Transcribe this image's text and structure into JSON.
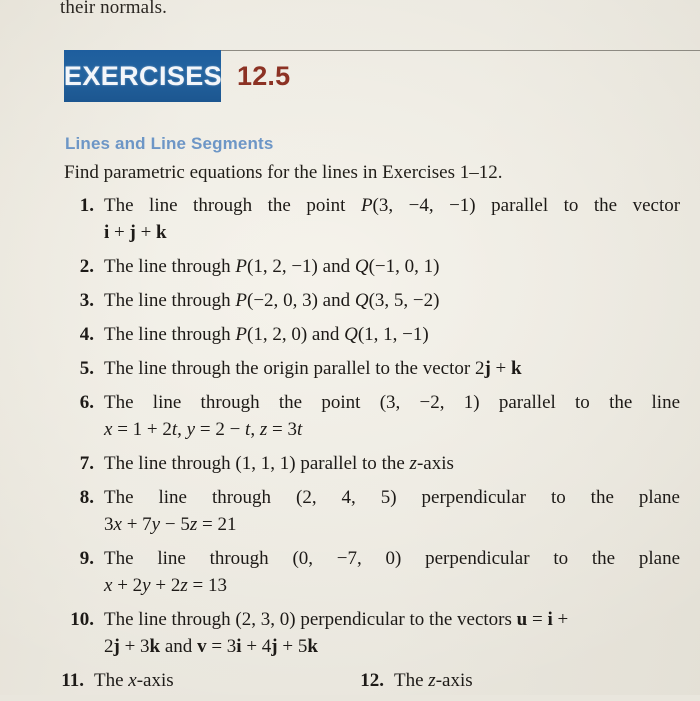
{
  "page": {
    "top_fragment": "their normals.",
    "background_color": "#e9e6dd",
    "rule_color": "#8d8a82"
  },
  "header": {
    "badge_label": "EXERCISES",
    "section_number": "12.5",
    "badge_color": "#1f5f9c",
    "badge_text_color": "#f3f6fa",
    "number_color": "#8c3224"
  },
  "subsection": {
    "title": "Lines and Line Segments",
    "title_color": "#6d96c6",
    "directions": "Find parametric equations for the lines in Exercises 1–12."
  },
  "exercises": [
    {
      "number": "1.",
      "lines": [
        {
          "text": "The line through the point P(3, −4, −1) parallel to the vector",
          "justify": true
        },
        {
          "text": "i + j + k",
          "justify": false
        }
      ]
    },
    {
      "number": "2.",
      "lines": [
        {
          "text": "The line through P(1, 2, −1) and Q(−1, 0, 1)",
          "justify": false
        }
      ]
    },
    {
      "number": "3.",
      "lines": [
        {
          "text": "The line through P(−2, 0, 3) and Q(3, 5, −2)",
          "justify": false
        }
      ]
    },
    {
      "number": "4.",
      "lines": [
        {
          "text": "The line through P(1, 2, 0) and Q(1, 1, −1)",
          "justify": false
        }
      ]
    },
    {
      "number": "5.",
      "lines": [
        {
          "text": "The line through the origin parallel to the vector 2j + k",
          "justify": false
        }
      ]
    },
    {
      "number": "6.",
      "lines": [
        {
          "text": "The line through the point (3, −2, 1) parallel to the line",
          "justify": true
        },
        {
          "text": "x = 1 + 2t, y = 2 − t, z = 3t",
          "justify": false
        }
      ]
    },
    {
      "number": "7.",
      "lines": [
        {
          "text": "The line through (1, 1, 1) parallel to the z-axis",
          "justify": false
        }
      ]
    },
    {
      "number": "8.",
      "lines": [
        {
          "text": "The line through (2, 4, 5) perpendicular to the plane",
          "justify": true
        },
        {
          "text": "3x + 7y − 5z = 21",
          "justify": false
        }
      ]
    },
    {
      "number": "9.",
      "lines": [
        {
          "text": "The line through (0, −7, 0) perpendicular to the plane",
          "justify": true
        },
        {
          "text": "x + 2y + 2z = 13",
          "justify": false
        }
      ]
    },
    {
      "number": "10.",
      "lines": [
        {
          "text": "The line through (2, 3, 0) perpendicular to the vectors u = i +",
          "justify": false
        },
        {
          "text": "2j + 3k and v = 3i + 4j + 5k",
          "justify": false
        }
      ]
    }
  ],
  "exercise_pair": {
    "left": {
      "number": "11.",
      "text": "The x-axis"
    },
    "right": {
      "number": "12.",
      "text": "The z-axis"
    }
  }
}
